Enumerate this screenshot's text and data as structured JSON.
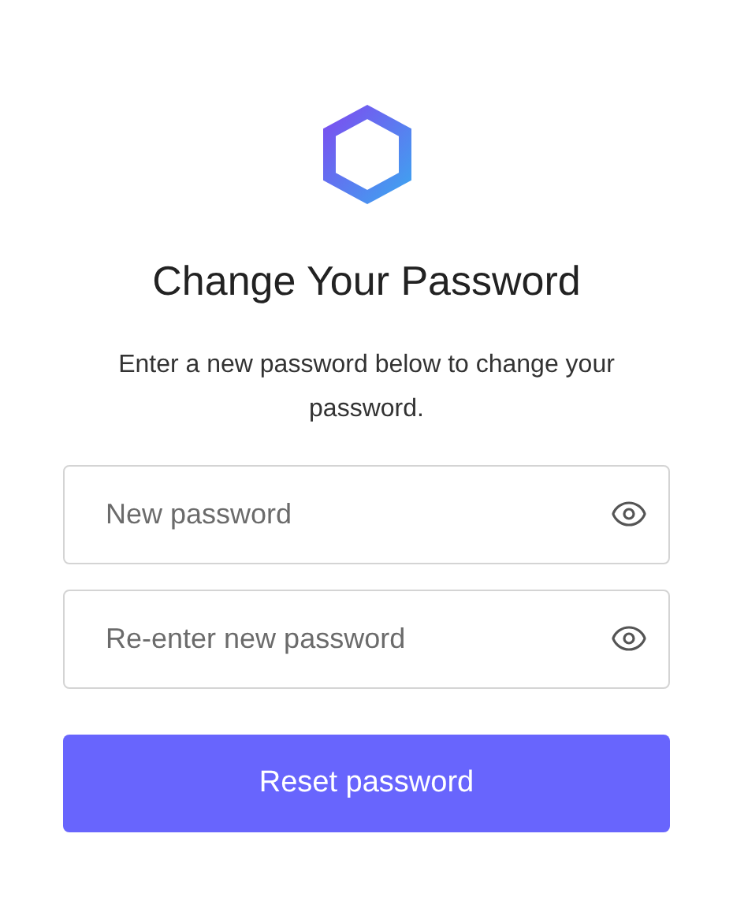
{
  "title": "Change Your Password",
  "description": "Enter a new password below to change your password.",
  "fields": [
    {
      "placeholder": "New password"
    },
    {
      "placeholder": "Re-enter new password"
    }
  ],
  "button": "Reset password"
}
